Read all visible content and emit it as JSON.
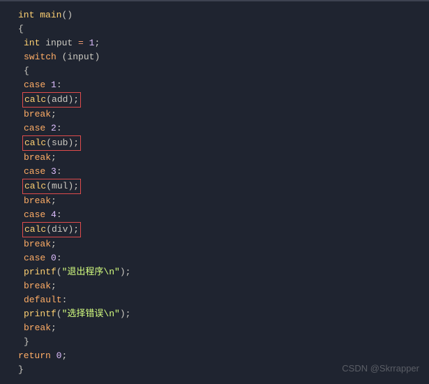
{
  "code": {
    "kw_int": "int",
    "fn_main": "main",
    "var_input": "input",
    "eq": "=",
    "one": "1",
    "kw_switch": "switch",
    "lbrace": "{",
    "rbrace": "}",
    "lparen": "(",
    "rparen": ")",
    "rparen_semi": ");",
    "empty_parens": "()",
    "semi": ";",
    "kw_case": "case",
    "colon": ":",
    "c1": "1",
    "c2": "2",
    "c3": "3",
    "c4": "4",
    "c0": "0",
    "fn_calc": "calc",
    "p_add": "add",
    "p_sub": "sub",
    "p_mul": "mul",
    "p_div": "div",
    "kw_break": "break",
    "fn_printf": "printf",
    "str_exit": "\"退出程序\\n\"",
    "str_err": "\"选择错误\\n\"",
    "kw_default": "default",
    "kw_return": "return",
    "zero": "0"
  },
  "watermark": "CSDN @Skrrapper"
}
